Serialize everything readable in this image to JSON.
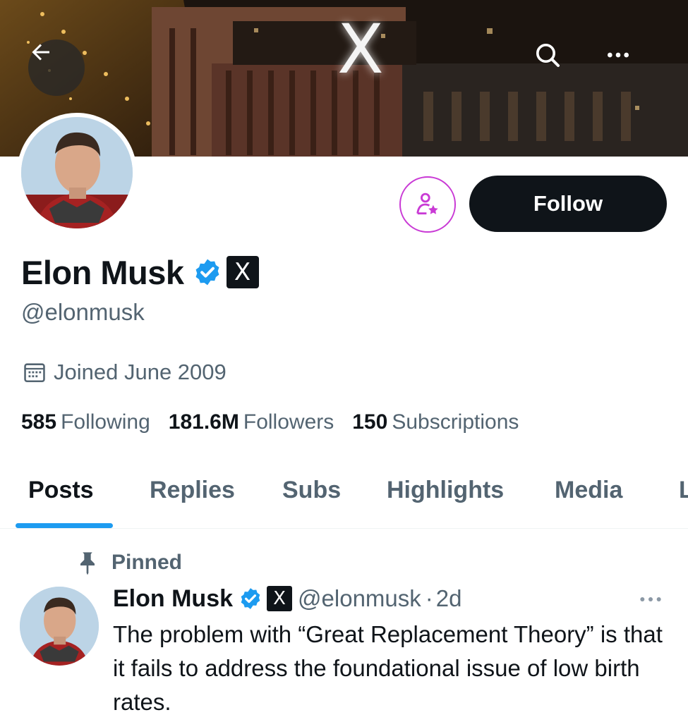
{
  "header": {
    "back_icon": "arrow-left-icon",
    "search_icon": "search-icon",
    "more_icon": "more-horizontal-icon",
    "banner_sign": "X"
  },
  "profile": {
    "display_name": "Elon Musk",
    "handle": "@elonmusk",
    "joined": "Joined June 2009",
    "follow_label": "Follow",
    "verified_icon": "verified-badge-icon",
    "affiliate_badge": "X",
    "stats": {
      "following_count": "585",
      "following_label": "Following",
      "followers_count": "181.6M",
      "followers_label": "Followers",
      "subscriptions_count": "150",
      "subscriptions_label": "Subscriptions"
    }
  },
  "tabs": [
    {
      "label": "Posts",
      "active": true
    },
    {
      "label": "Replies",
      "active": false
    },
    {
      "label": "Subs",
      "active": false
    },
    {
      "label": "Highlights",
      "active": false
    },
    {
      "label": "Media",
      "active": false
    },
    {
      "label": "L",
      "active": false
    }
  ],
  "pinned_post": {
    "pinned_label": "Pinned",
    "author_name": "Elon Musk",
    "author_handle": "@elonmusk",
    "separator": "·",
    "time": "2d",
    "text": "The problem with “Great Replacement Theory” is that it fails to address the foundational issue of low birth rates."
  },
  "colors": {
    "accent_blue": "#1d9bf0",
    "text_primary": "#0f1419",
    "text_secondary": "#536471",
    "subscribe_purple": "#c93ad5"
  }
}
